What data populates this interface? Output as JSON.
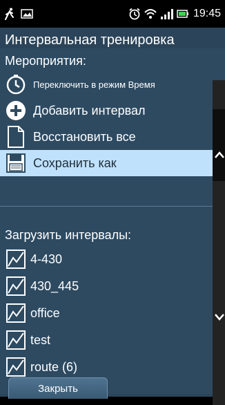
{
  "status_bar": {
    "time": "19:45"
  },
  "header": {
    "title": "Интервальная тренировка"
  },
  "events": {
    "label": "Мероприятия:",
    "items": [
      {
        "label": "Переключить в режим Время",
        "icon": "stopwatch-icon"
      },
      {
        "label": "Добавить интервал",
        "icon": "plus-circle-icon"
      },
      {
        "label": "Восстановить все",
        "icon": "document-icon"
      },
      {
        "label": "Сохранить как",
        "icon": "floppy-disk-icon",
        "selected": true
      }
    ]
  },
  "load": {
    "label": "Загрузить интервалы:",
    "items": [
      {
        "label": "4-430",
        "icon": "chart-icon"
      },
      {
        "label": "430_445",
        "icon": "chart-icon"
      },
      {
        "label": "office",
        "icon": "chart-icon"
      },
      {
        "label": "test",
        "icon": "chart-icon"
      },
      {
        "label": "route (6)",
        "icon": "chart-icon"
      }
    ]
  },
  "footer": {
    "close_label": "Закрыть"
  },
  "colors": {
    "background": "#2d4a61",
    "selected": "#bfe1fb",
    "scrollbar": "#232323"
  }
}
